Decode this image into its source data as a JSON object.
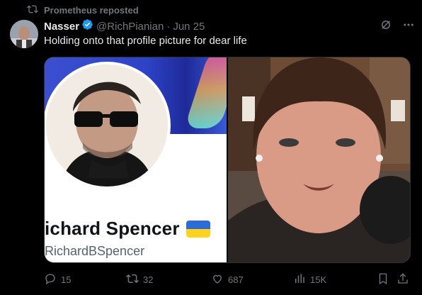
{
  "repost": {
    "icon": "repost-icon",
    "text": "Prometheus reposted"
  },
  "author": {
    "name": "Nasser",
    "verified": true,
    "verified_color": "#1d9bf0",
    "handle": "@RichPianian",
    "separator": "·",
    "date": "Jun 25",
    "avatar_icon": "avatar"
  },
  "tweet": {
    "text": "Holding onto that profile picture for dear life"
  },
  "media": {
    "left": {
      "display_name": "ichard Spencer",
      "username": "RichardBSpencer",
      "flag_colors": [
        "#2b6cd8",
        "#ffd21f"
      ]
    },
    "right": {
      "description_icon": "video-frame"
    }
  },
  "actions": {
    "replies": "15",
    "reposts": "32",
    "likes": "687",
    "views": "15K"
  },
  "colors": {
    "background": "#000000",
    "text": "#e7e9ea",
    "muted": "#71767b"
  }
}
